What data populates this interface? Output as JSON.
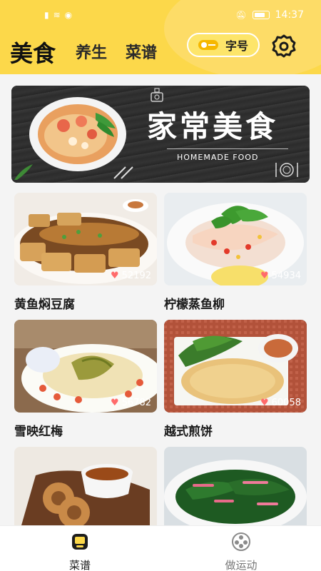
{
  "status_bar": {
    "left_icons": [
      "sim-icon",
      "wifi-icon",
      "notification-icon"
    ],
    "right_icons": [
      "mute-icon",
      "battery-icon"
    ],
    "time": "14:37"
  },
  "header": {
    "active_tab": "美食",
    "tabs": [
      "养生",
      "菜谱"
    ],
    "font_size_button": "字号",
    "settings_icon": "gear-icon",
    "accent_color": "#fcd84a"
  },
  "banner": {
    "title": "家常美食",
    "subtitle": "HOMEMADE FOOD"
  },
  "recipes": [
    {
      "name": "黄鱼焖豆腐",
      "likes": "52192"
    },
    {
      "name": "柠檬蒸鱼柳",
      "likes": "54934"
    },
    {
      "name": "雪映红梅",
      "likes": "56782"
    },
    {
      "name": "越式煎饼",
      "likes": "60058"
    },
    {
      "name": "",
      "likes": ""
    },
    {
      "name": "",
      "likes": ""
    }
  ],
  "tabbar": {
    "items": [
      {
        "label": "菜谱",
        "icon": "recipe-icon",
        "active": true
      },
      {
        "label": "做运动",
        "icon": "film-reel-icon",
        "active": false
      }
    ]
  }
}
